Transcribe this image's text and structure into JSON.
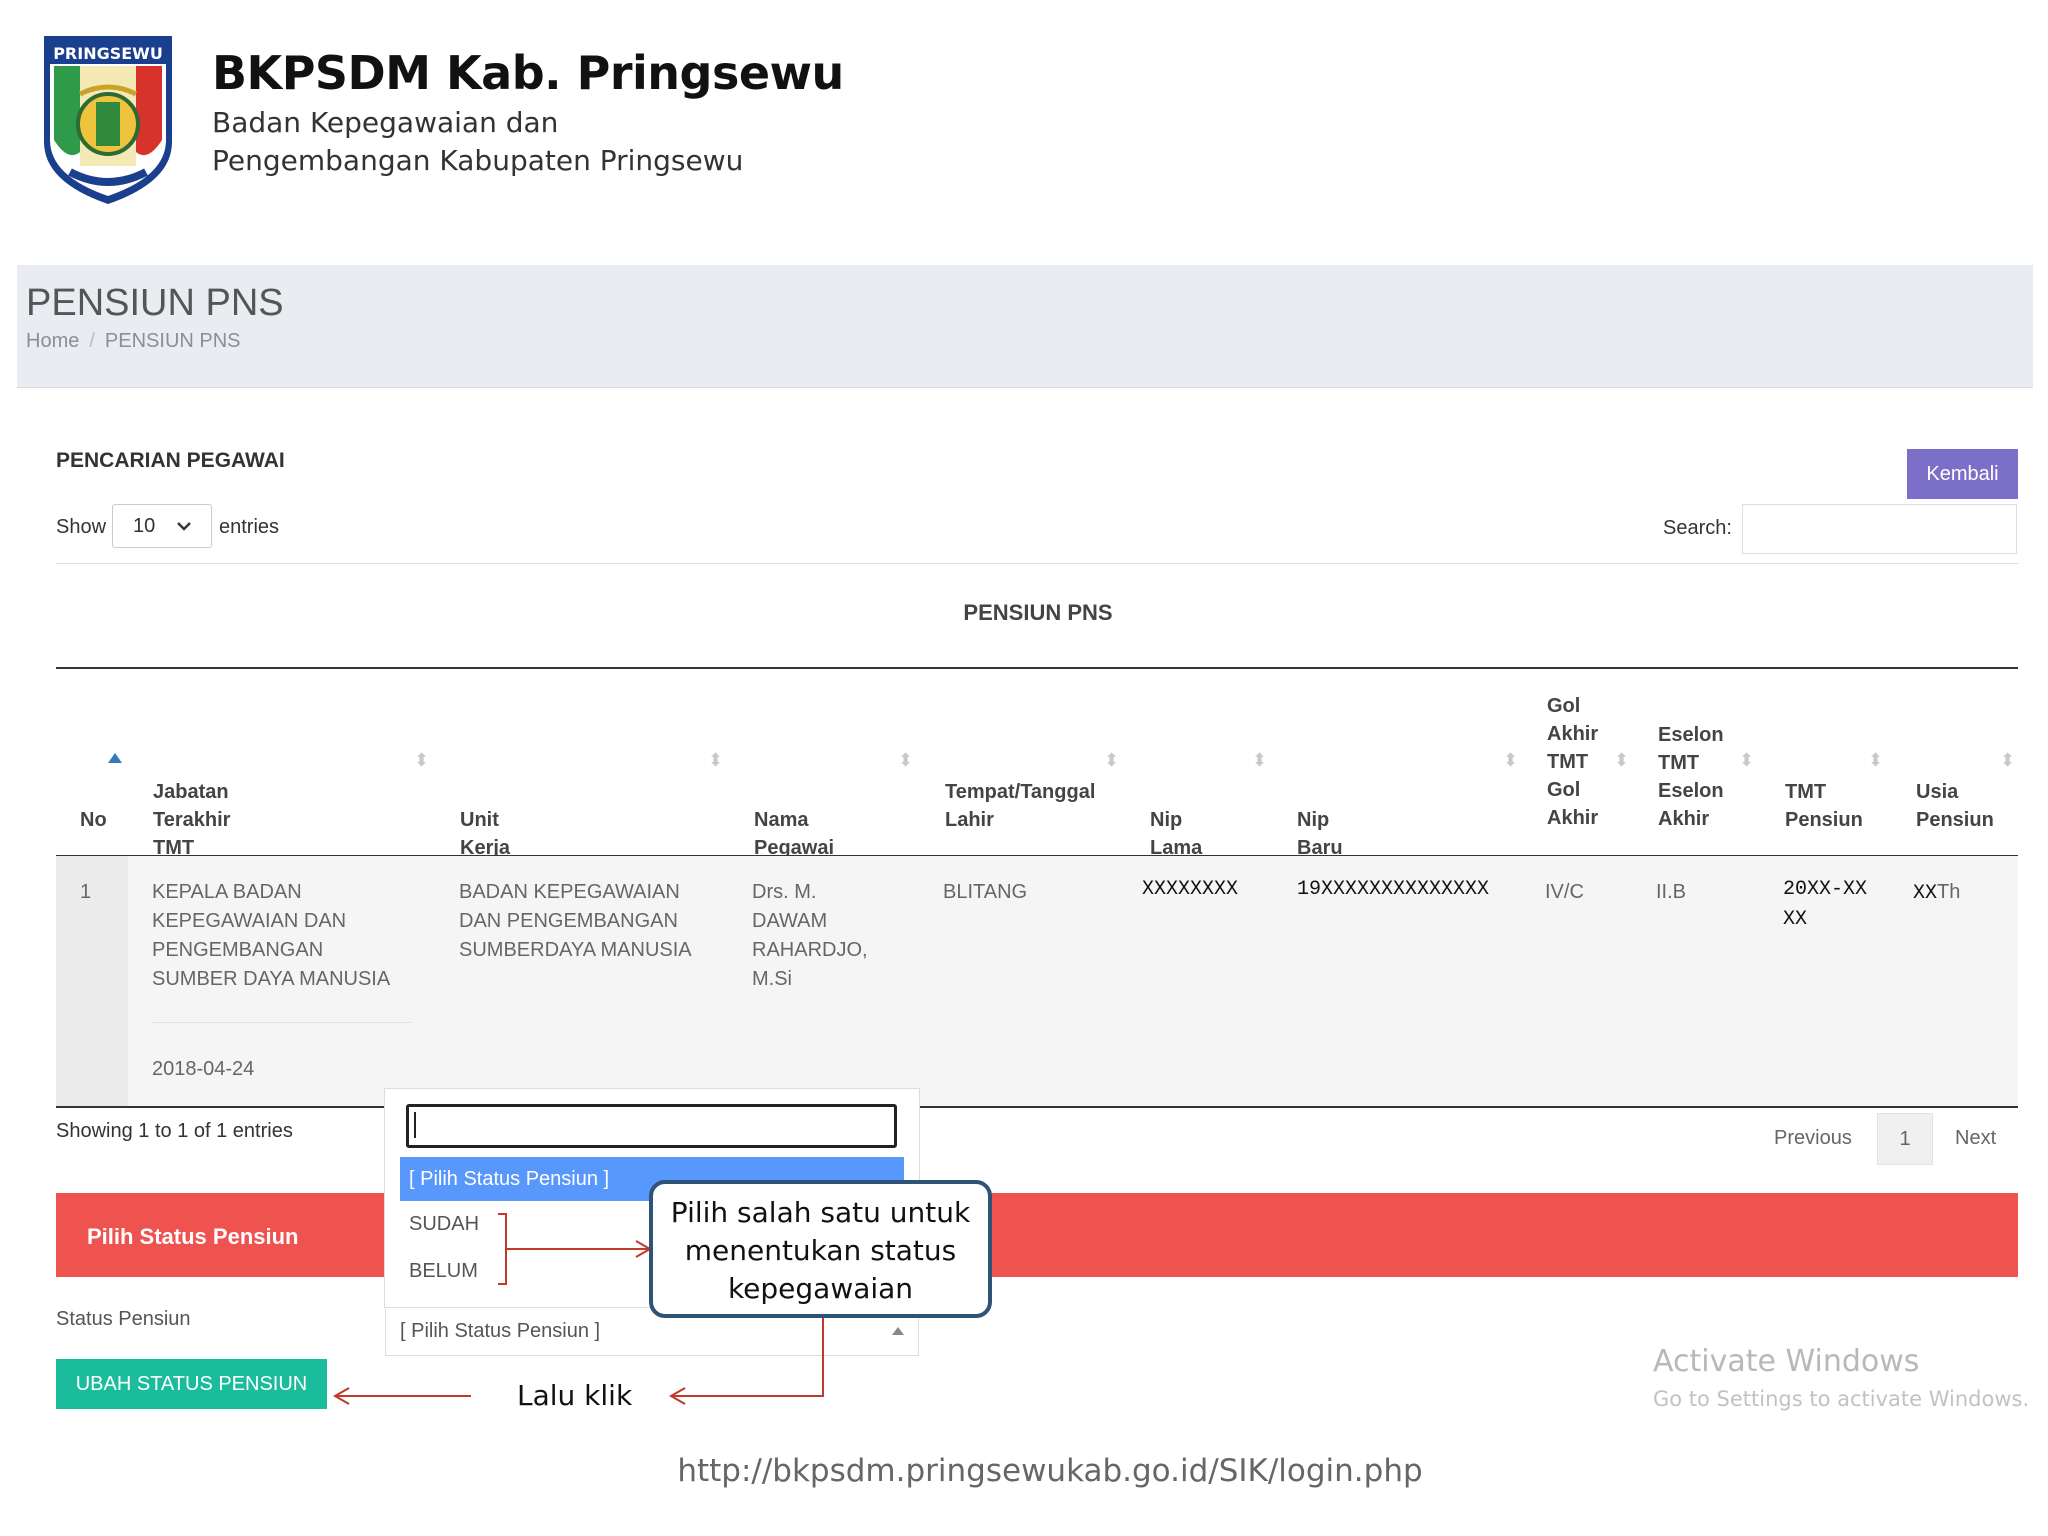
{
  "header": {
    "logo_text": "PRINGSEWU",
    "title": "BKPSDM Kab. Pringsewu",
    "subtitle_line1": "Badan Kepegawaian dan",
    "subtitle_line2": "Pengembangan Kabupaten Pringsewu"
  },
  "page": {
    "title": "PENSIUN PNS",
    "breadcrumb": [
      "Home",
      "PENSIUN PNS"
    ]
  },
  "card": {
    "section_title": "PENCARIAN PEGAWAI",
    "back_button": "Kembali",
    "show_label": "Show",
    "show_value": "10",
    "entries_label": "entries",
    "search_label": "Search:",
    "table_caption": "PENSIUN PNS"
  },
  "table": {
    "columns": [
      {
        "line1": "No"
      },
      {
        "line1": "Jabatan Terakhir",
        "line2": "TMT Jabatan"
      },
      {
        "line1": "Unit Kerja"
      },
      {
        "line1": "Nama Pegawai"
      },
      {
        "line1": "Tempat/Tanggal",
        "line2": "Lahir"
      },
      {
        "line1": "Nip Lama"
      },
      {
        "line1": "Nip Baru"
      },
      {
        "line1": "Gol",
        "line2": "Akhir",
        "line3": "TMT",
        "line4": "Gol",
        "line5": "Akhir"
      },
      {
        "line1": "Eselon",
        "line2": "TMT",
        "line3": "Eselon",
        "line4": "Akhir"
      },
      {
        "line1": "TMT",
        "line2": "Pensiun"
      },
      {
        "line1": "Usia",
        "line2": "Pensiun"
      }
    ],
    "rows": [
      {
        "no": "1",
        "jabatan": [
          "KEPALA BADAN",
          "KEPEGAWAIAN DAN",
          "PENGEMBANGAN",
          "SUMBER DAYA MANUSIA"
        ],
        "tmt_jabatan": "2018-04-24",
        "unit_kerja": [
          "BADAN KEPEGAWAIAN",
          "DAN PENGEMBANGAN",
          "SUMBERDAYA MANUSIA"
        ],
        "nama": [
          "Drs. M.",
          "DAWAM",
          "RAHARDJO,",
          "M.Si"
        ],
        "tempat_lahir": "BLITANG",
        "nip_lama": "XXXXXXXX",
        "nip_baru": "19XXXXXXXXXXXXXX",
        "gol_akhir": "IV/C",
        "eselon": "II.B",
        "tmt_pensiun_line1": "20XX-XX",
        "tmt_pensiun_line2": "XX",
        "usia_pensiun": "XX",
        "usia_unit": "Th"
      }
    ]
  },
  "pagination": {
    "info": "Showing 1 to 1 of 1 entries",
    "previous": "Previous",
    "page": "1",
    "next": "Next"
  },
  "status_panel": {
    "title": "Pilih Status Pensiun",
    "field_label": "Status Pensiun",
    "selected_value": "[ Pilih Status Pensiun ]",
    "submit_button": "UBAH STATUS PENSIUN"
  },
  "dropdown": {
    "options": [
      "[ Pilih Status Pensiun ]",
      "SUDAH",
      "BELUM"
    ]
  },
  "annotations": {
    "callout": [
      "Pilih salah satu untuk",
      "menentukan status",
      "kepegawaian"
    ],
    "then_click": "Lalu klik"
  },
  "watermark": {
    "title": "Activate Windows",
    "subtitle": "Go to Settings to activate Windows."
  },
  "footer_url": "http://bkpsdm.pringsewukab.go.id/SIK/login.php",
  "colors": {
    "header_band": "#e9ecf0",
    "back_button": "#7b6fc7",
    "status_bar": "#ef5350",
    "submit_button": "#1abc9c",
    "dropdown_highlight": "#5897fb",
    "callout_border": "#2f5277",
    "arrow": "#c0392b"
  }
}
